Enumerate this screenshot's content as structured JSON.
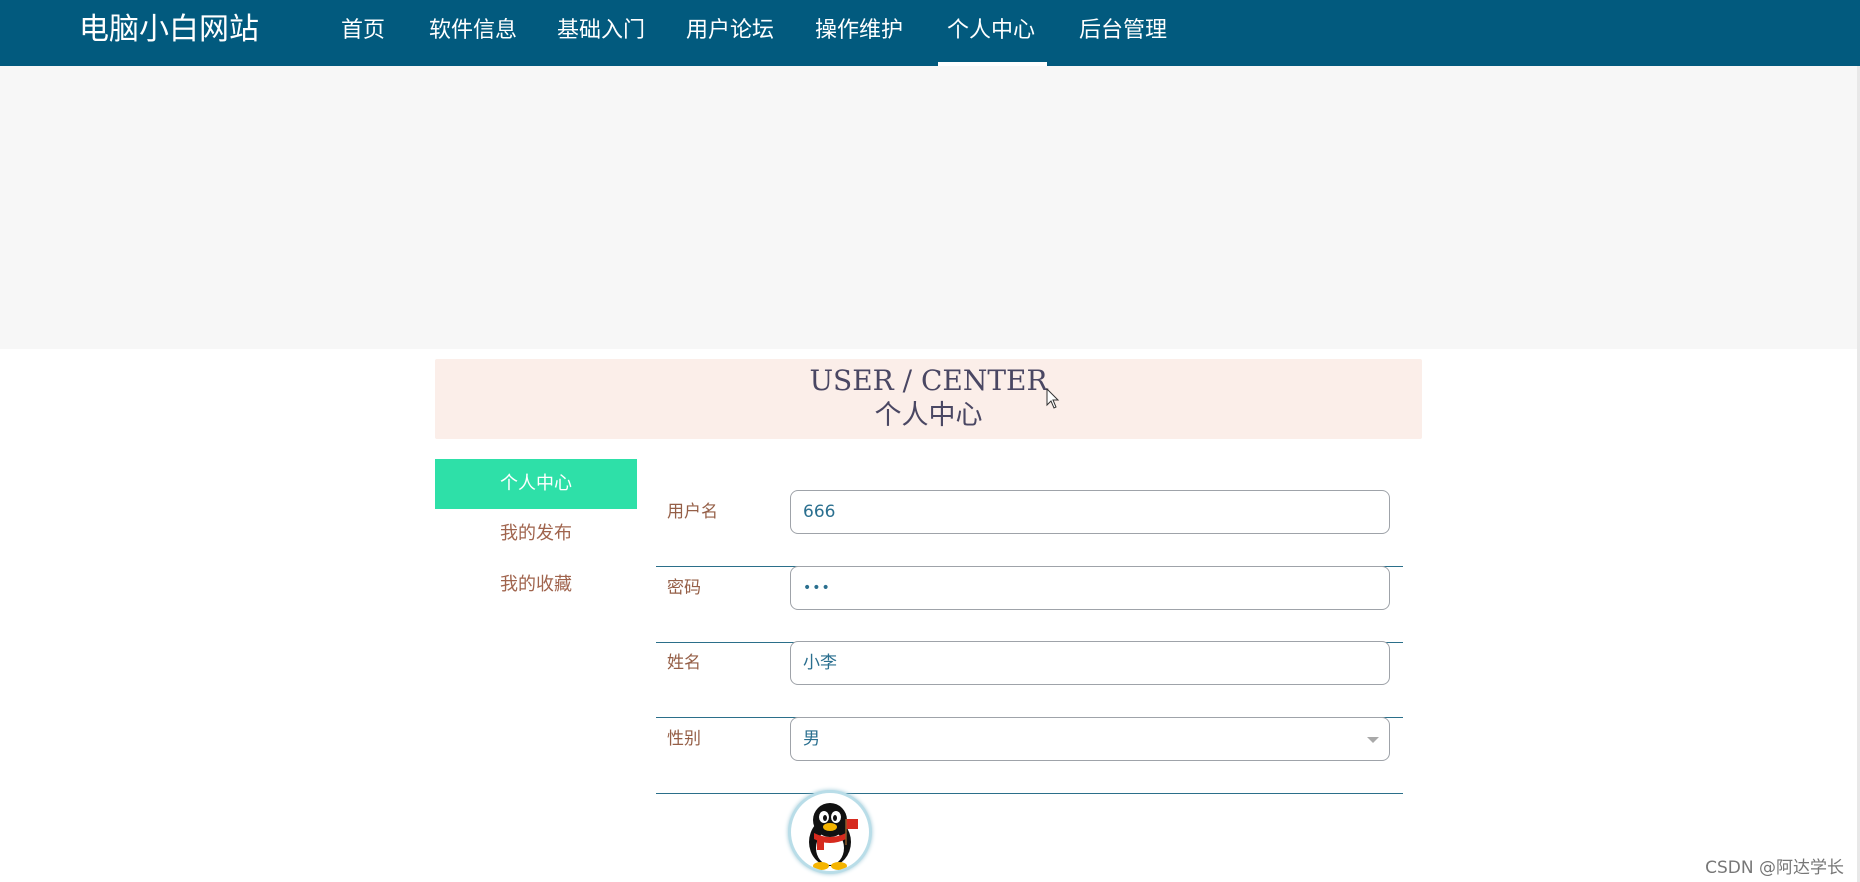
{
  "site": {
    "brand": "电脑小白网站"
  },
  "nav": {
    "items": [
      {
        "label": "首页"
      },
      {
        "label": "软件信息"
      },
      {
        "label": "基础入门"
      },
      {
        "label": "用户论坛"
      },
      {
        "label": "操作维护"
      },
      {
        "label": "个人中心",
        "active": true
      },
      {
        "label": "后台管理"
      }
    ]
  },
  "section_header": {
    "english": "USER / CENTER",
    "chinese": "个人中心"
  },
  "sidebar": {
    "items": [
      {
        "label": "个人中心",
        "active": true
      },
      {
        "label": "我的发布"
      },
      {
        "label": "我的收藏"
      }
    ]
  },
  "form": {
    "username": {
      "label": "用户名",
      "value": "666"
    },
    "password": {
      "label": "密码",
      "value": "•••"
    },
    "name": {
      "label": "姓名",
      "value": "小李"
    },
    "gender": {
      "label": "性别",
      "value": "男"
    }
  },
  "watermark": "CSDN @阿达学长",
  "colors": {
    "nav_bg": "#025a7e",
    "sidebar_active": "#2ee0a8",
    "header_bg": "#fbeee9",
    "label_color": "#955f47",
    "input_text": "#2a6f8f"
  },
  "icons": {
    "avatar": "qq-penguin-avatar",
    "cursor": "mouse-pointer-icon",
    "select": "chevron-down-icon"
  }
}
